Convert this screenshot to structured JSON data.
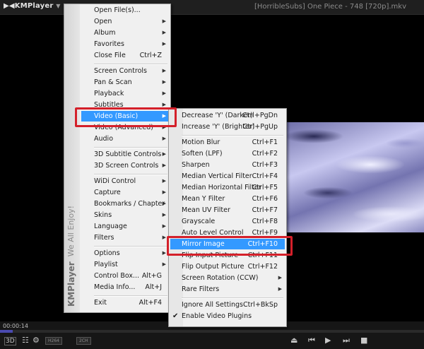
{
  "app": {
    "logo": "KMPlayer",
    "window_title": "[HorribleSubs] One Piece - 748 [720p].mkv"
  },
  "sidebar_brand": {
    "name": "KMPlayer",
    "tagline": "We All Enjoy!"
  },
  "main_menu": [
    {
      "label": "Open File(s)...",
      "shortcut": "",
      "arrow": false
    },
    {
      "label": "Open",
      "shortcut": "",
      "arrow": true
    },
    {
      "label": "Album",
      "shortcut": "",
      "arrow": true
    },
    {
      "label": "Favorites",
      "shortcut": "",
      "arrow": true
    },
    {
      "label": "Close File",
      "shortcut": "Ctrl+Z",
      "arrow": false
    },
    {
      "separator": true
    },
    {
      "label": "Screen Controls",
      "shortcut": "",
      "arrow": true
    },
    {
      "label": "Pan & Scan",
      "shortcut": "",
      "arrow": true
    },
    {
      "label": "Playback",
      "shortcut": "",
      "arrow": true
    },
    {
      "label": "Subtitles",
      "shortcut": "",
      "arrow": true
    },
    {
      "label": "Video (Basic)",
      "shortcut": "",
      "arrow": true,
      "highlighted": true
    },
    {
      "label": "Video (Advanced)",
      "shortcut": "",
      "arrow": true
    },
    {
      "label": "Audio",
      "shortcut": "",
      "arrow": true
    },
    {
      "separator": true
    },
    {
      "label": "3D Subtitle Controls",
      "shortcut": "",
      "arrow": true
    },
    {
      "label": "3D Screen Controls",
      "shortcut": "",
      "arrow": true
    },
    {
      "separator": true
    },
    {
      "label": "WiDi Control",
      "shortcut": "",
      "arrow": true
    },
    {
      "label": "Capture",
      "shortcut": "",
      "arrow": true
    },
    {
      "label": "Bookmarks / Chapter",
      "shortcut": "",
      "arrow": true
    },
    {
      "label": "Skins",
      "shortcut": "",
      "arrow": true
    },
    {
      "label": "Language",
      "shortcut": "",
      "arrow": true
    },
    {
      "label": "Filters",
      "shortcut": "",
      "arrow": true
    },
    {
      "separator": true
    },
    {
      "label": "Options",
      "shortcut": "",
      "arrow": true
    },
    {
      "label": "Playlist",
      "shortcut": "",
      "arrow": true
    },
    {
      "label": "Control Box...",
      "shortcut": "Alt+G",
      "arrow": false
    },
    {
      "label": "Media Info...",
      "shortcut": "Alt+J",
      "arrow": false
    },
    {
      "separator": true
    },
    {
      "label": "Exit",
      "shortcut": "Alt+F4",
      "arrow": false
    }
  ],
  "sub_menu": [
    {
      "label": "Decrease 'Y' (Darker)",
      "shortcut": "Ctrl+PgDn"
    },
    {
      "label": "Increase 'Y' (Brighter)",
      "shortcut": "Ctrl+PgUp"
    },
    {
      "separator": true
    },
    {
      "label": "Motion Blur",
      "shortcut": "Ctrl+F1"
    },
    {
      "label": "Soften (LPF)",
      "shortcut": "Ctrl+F2"
    },
    {
      "label": "Sharpen",
      "shortcut": "Ctrl+F3"
    },
    {
      "label": "Median Vertical Filter",
      "shortcut": "Ctrl+F4"
    },
    {
      "label": "Median Horizontal Filter",
      "shortcut": "Ctrl+F5"
    },
    {
      "label": "Mean Y Filter",
      "shortcut": "Ctrl+F6"
    },
    {
      "label": "Mean UV Filter",
      "shortcut": "Ctrl+F7"
    },
    {
      "label": "Grayscale",
      "shortcut": "Ctrl+F8"
    },
    {
      "label": "Auto Level Control",
      "shortcut": "Ctrl+F9"
    },
    {
      "label": "Mirror Image",
      "shortcut": "Ctrl+F10",
      "highlighted": true
    },
    {
      "label": "Flip Input Picture",
      "shortcut": "Ctrl+F11"
    },
    {
      "label": "Flip Output Picture",
      "shortcut": "Ctrl+F12"
    },
    {
      "label": "Screen Rotation (CCW)",
      "shortcut": "",
      "arrow": true
    },
    {
      "label": "Rare Filters",
      "shortcut": "",
      "arrow": true
    },
    {
      "separator": true
    },
    {
      "label": "Ignore All Settings",
      "shortcut": "Ctrl+BkSp"
    },
    {
      "label": "Enable Video Plugins",
      "shortcut": "",
      "checked": true
    }
  ],
  "controls": {
    "time": "00:00:14",
    "progress_fraction": 0.03,
    "badge_1": "H264",
    "badge_2": "2CH",
    "label_3d": "3D"
  },
  "colors": {
    "highlight": "#3399ff",
    "callout": "#d4202a",
    "seek_fill": "#4a4ab0"
  },
  "icons": {
    "settings": "gear-icon",
    "info": "info-icon",
    "eject": "eject-icon",
    "prev": "prev-icon",
    "play": "play-icon",
    "next": "next-icon",
    "stop": "stop-icon"
  }
}
